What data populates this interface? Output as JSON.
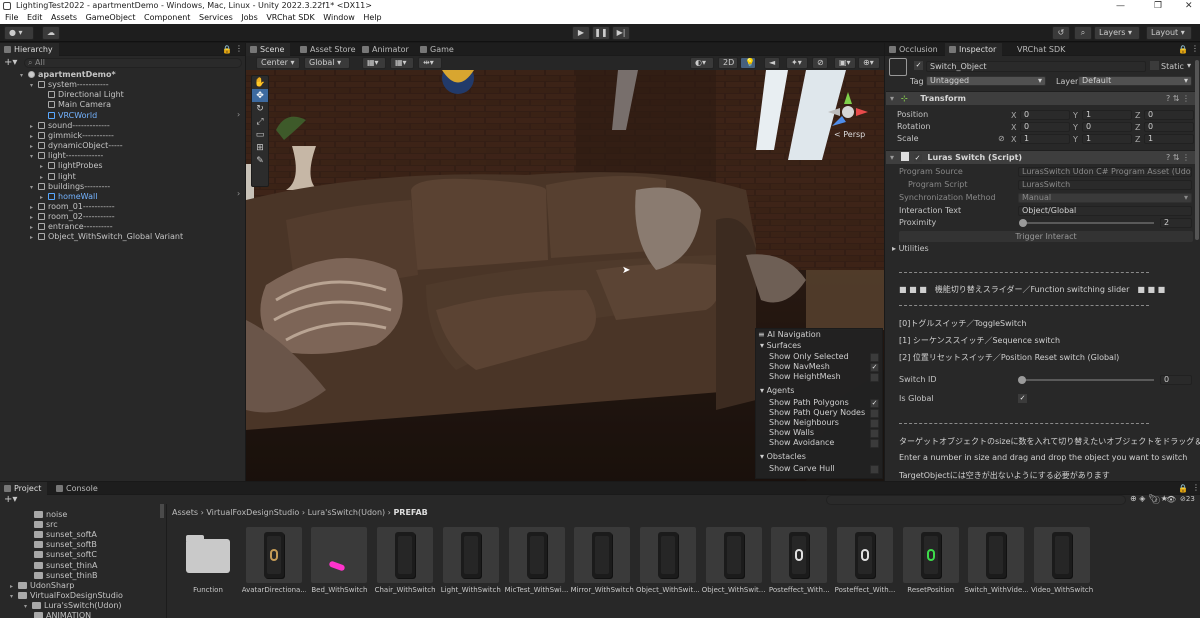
{
  "title_bar": {
    "title": "LightingTest2022 - apartmentDemo - Windows, Mac, Linux - Unity 2022.3.22f1* <DX11>"
  },
  "menu": [
    "File",
    "Edit",
    "Assets",
    "GameObject",
    "Component",
    "Services",
    "Jobs",
    "VRChat SDK",
    "Window",
    "Help"
  ],
  "toolbar": {
    "layers": "Layers",
    "layout": "Layout"
  },
  "hierarchy": {
    "tab": "Hierarchy",
    "search_placeholder": "All",
    "items": [
      {
        "label": "apartmentDemo*",
        "depth": 0,
        "expanded": true,
        "icon": "scene-icon"
      },
      {
        "label": "system-----------",
        "depth": 1,
        "expanded": true
      },
      {
        "label": "Directional Light",
        "depth": 2
      },
      {
        "label": "Main Camera",
        "depth": 2
      },
      {
        "label": "VRCWorld",
        "depth": 2,
        "prefab": true
      },
      {
        "label": "sound-------------",
        "depth": 1,
        "collapsed": true
      },
      {
        "label": "gimmick-----------",
        "depth": 1,
        "collapsed": true
      },
      {
        "label": "dynamicObject-----",
        "depth": 1,
        "collapsed": true
      },
      {
        "label": "light-------------",
        "depth": 1,
        "expanded": true
      },
      {
        "label": "lightProbes",
        "depth": 2,
        "collapsed": true
      },
      {
        "label": "light",
        "depth": 2,
        "collapsed": true
      },
      {
        "label": "buildings---------",
        "depth": 1,
        "expanded": true
      },
      {
        "label": "homeWall",
        "depth": 2,
        "collapsed": true,
        "prefab": true
      },
      {
        "label": "room_01-----------",
        "depth": 1,
        "collapsed": true
      },
      {
        "label": "room_02-----------",
        "depth": 1,
        "collapsed": true
      },
      {
        "label": "entrance----------",
        "depth": 1,
        "collapsed": true
      },
      {
        "label": "Object_WithSwitch_Global Variant",
        "depth": 1,
        "collapsed": true
      }
    ]
  },
  "scene_tabs": [
    "Scene",
    "Asset Store",
    "Animator",
    "Game"
  ],
  "scene_toolbar": {
    "pivot": "Center",
    "space": "Global",
    "mode_2d": "2D"
  },
  "gizmo": {
    "label": "< Persp"
  },
  "ai_navigation": {
    "title": "AI Navigation",
    "sections": [
      {
        "name": "Surfaces",
        "items": [
          {
            "label": "Show Only Selected",
            "checked": false
          },
          {
            "label": "Show NavMesh",
            "checked": true
          },
          {
            "label": "Show HeightMesh",
            "checked": false
          }
        ]
      },
      {
        "name": "Agents",
        "items": [
          {
            "label": "Show Path Polygons",
            "checked": true
          },
          {
            "label": "Show Path Query Nodes",
            "checked": false
          },
          {
            "label": "Show Neighbours",
            "checked": false
          },
          {
            "label": "Show Walls",
            "checked": false
          },
          {
            "label": "Show Avoidance",
            "checked": false
          }
        ]
      },
      {
        "name": "Obstacles",
        "items": [
          {
            "label": "Show Carve Hull",
            "checked": false
          }
        ]
      }
    ]
  },
  "inspector": {
    "tabs": [
      "Occlusion",
      "Inspector",
      "VRChat SDK"
    ],
    "object_name": "Switch_Object",
    "static_label": "Static",
    "tag_label": "Tag",
    "tag_value": "Untagged",
    "layer_label": "Layer",
    "layer_value": "Default",
    "transform": {
      "title": "Transform",
      "rows": [
        {
          "label": "Position",
          "x": "0",
          "y": "1",
          "z": "0"
        },
        {
          "label": "Rotation",
          "x": "0",
          "y": "0",
          "z": "0"
        },
        {
          "label": "Scale",
          "x": "1",
          "y": "1",
          "z": "1"
        }
      ],
      "axis": [
        "X",
        "Y",
        "Z"
      ]
    },
    "script": {
      "title": "Luras Switch (Script)",
      "program_source_label": "Program Source",
      "program_source_value": "LurasSwitch Udon C# Program Asset (Udon",
      "program_script_label": "Program Script",
      "program_script_value": "LurasSwitch",
      "sync_label": "Synchronization Method",
      "sync_value": "Manual",
      "interaction_label": "Interaction Text",
      "interaction_value": "Object/Global",
      "proximity_label": "Proximity",
      "proximity_value": "2",
      "proximity_level": 0.0,
      "trigger_label": "Trigger Interact",
      "utilities_label": "Utilities"
    },
    "notes": {
      "header1": "■ ■ ■　機能切り替えスライダー／Function switching slider　■ ■ ■",
      "mode0": "[0]トグルスイッチ／ToggleSwitch",
      "mode1": "[1] シーケンススイッチ／Sequence switch",
      "mode2": "[2] 位置リセットスイッチ／Position Reset switch (Global)",
      "switch_id_label": "Switch ID",
      "switch_id_value": "0",
      "is_global_label": "Is Global",
      "is_global_checked": true,
      "jp_instruction": "ターゲットオブジェクトのsizeに数を入れて切り替えたいオブジェクトをドラッグ＆ドロップ",
      "en_instruction": "Enter a number in size and drag and drop the object you want to switch",
      "jp_warning": "TargetObjectには空きが出ないようにする必要があります"
    }
  },
  "project": {
    "tabs": [
      "Project",
      "Console"
    ],
    "breadcrumb": [
      "Assets",
      "VirtualFoxDesignStudio",
      "Lura'sSwitch(Udon)",
      "PREFAB"
    ],
    "item_count": "23",
    "tree": [
      {
        "label": "noise",
        "depth": 3
      },
      {
        "label": "src",
        "depth": 3
      },
      {
        "label": "sunset_softA",
        "depth": 3
      },
      {
        "label": "sunset_softB",
        "depth": 3
      },
      {
        "label": "sunset_softC",
        "depth": 3
      },
      {
        "label": "sunset_thinA",
        "depth": 3
      },
      {
        "label": "sunset_thinB",
        "depth": 3
      },
      {
        "label": "UdonSharp",
        "depth": 1
      },
      {
        "label": "VirtualFoxDesignStudio",
        "depth": 1
      },
      {
        "label": "Lura'sSwitch(Udon)",
        "depth": 2
      },
      {
        "label": "ANIMATION",
        "depth": 3
      }
    ],
    "assets": [
      {
        "label": "Function",
        "kind": "folder"
      },
      {
        "label": "AvatarDirectiona...",
        "kind": "switch",
        "accent": "#c49b56"
      },
      {
        "label": "Bed_WithSwitch",
        "kind": "pink",
        "accent": "#ff33cc"
      },
      {
        "label": "Chair_WithSwitch",
        "kind": "switch"
      },
      {
        "label": "Light_WithSwitch",
        "kind": "switch"
      },
      {
        "label": "MicTest_WithSwi...",
        "kind": "switch"
      },
      {
        "label": "Mirror_WithSwitch",
        "kind": "switch"
      },
      {
        "label": "Object_WithSwit...",
        "kind": "switch"
      },
      {
        "label": "Object_WithSwit...",
        "kind": "switch"
      },
      {
        "label": "Posteffect_With...",
        "kind": "switch",
        "accent": "#e0e0e0"
      },
      {
        "label": "Posteffect_With...",
        "kind": "switch",
        "accent": "#e0e0e0"
      },
      {
        "label": "ResetPosition",
        "kind": "switch",
        "accent": "#3ddc4a"
      },
      {
        "label": "Switch_WithVide...",
        "kind": "switch"
      },
      {
        "label": "Video_WithSwitch",
        "kind": "switch"
      }
    ]
  }
}
